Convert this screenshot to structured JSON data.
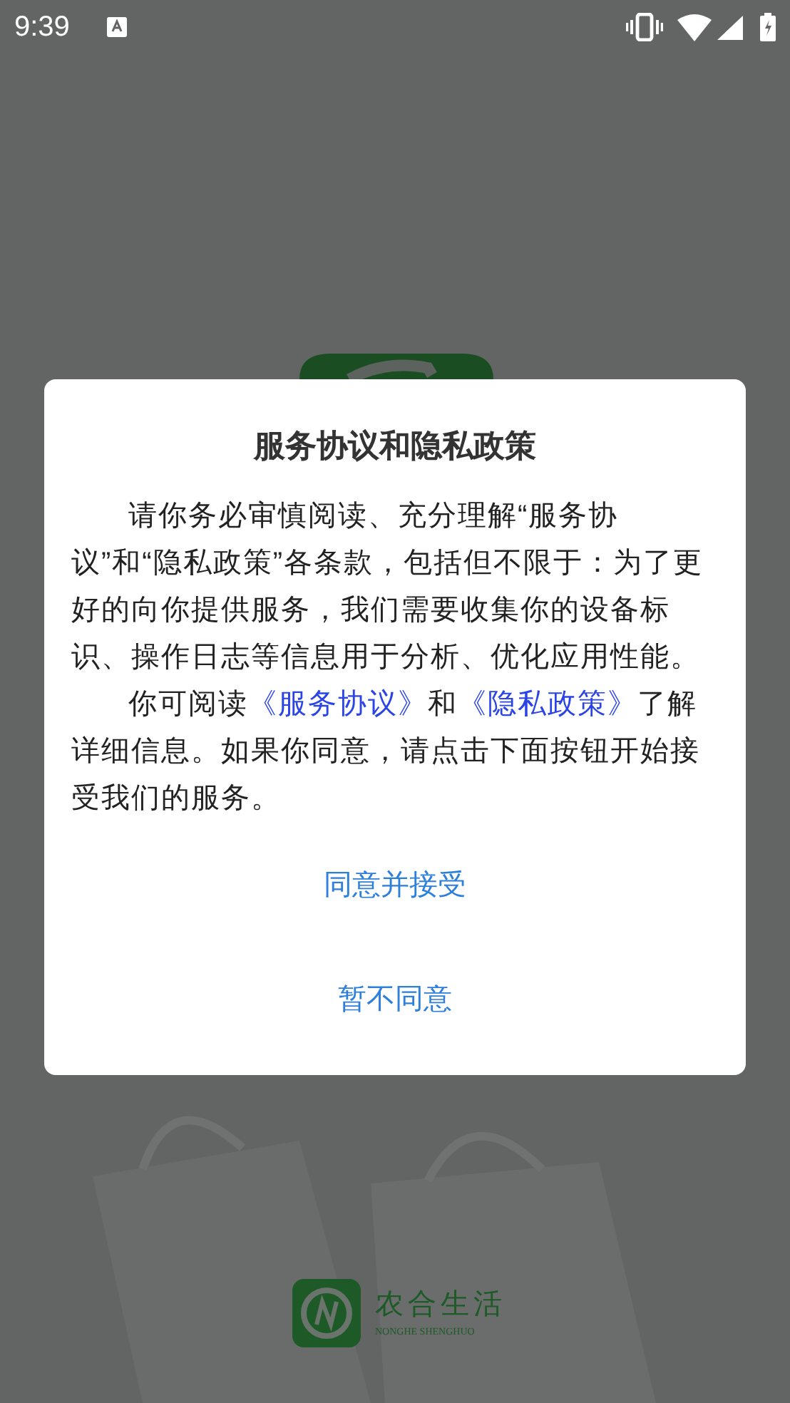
{
  "status_bar": {
    "time": "9:39"
  },
  "splash": {
    "brand": "农合生活",
    "brand_subtitle": "NONGHE SHENGHUO"
  },
  "dialog": {
    "title": "服务协议和隐私政策",
    "paragraphs": [
      [
        {
          "kind": "plain",
          "text": "请你务必审慎阅读、充分理解“服务协议”和“隐私政策”各条款，包括但不限于：为了更好的向你提供服务，我们需要收集你的设备标识、操作日志等信息用于分析、优化应用性能。"
        }
      ],
      [
        {
          "kind": "plain",
          "text": "你可阅读"
        },
        {
          "kind": "link",
          "text": "《服务协议》"
        },
        {
          "kind": "plain",
          "text": "和"
        },
        {
          "kind": "link",
          "text": "《隐私政策》"
        },
        {
          "kind": "plain",
          "text": "了解详细信息。如果你同意，请点击下面按钮开始接受我们的服务。"
        }
      ]
    ],
    "buttons": [
      "同意并接受",
      "暂不同意"
    ]
  }
}
